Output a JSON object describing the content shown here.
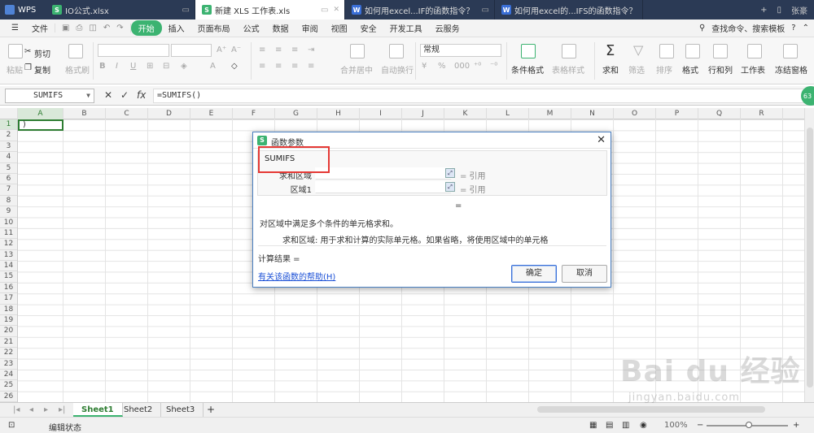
{
  "app": {
    "name": "WPS",
    "tabs": [
      {
        "label": "IO公式.xlsx",
        "icon": "S",
        "active": false
      },
      {
        "label": "新建 XLS 工作表.xls",
        "icon": "S",
        "active": true
      },
      {
        "label": "如何用excel...IF的函数指令？",
        "icon": "W",
        "active": false
      },
      {
        "label": "如何用excel的...IFS的函数指令？",
        "icon": "W",
        "active": false
      }
    ],
    "user": "张豪"
  },
  "menu": {
    "file": "文件",
    "start": "开始",
    "items": [
      "插入",
      "页面布局",
      "公式",
      "数据",
      "审阅",
      "视图",
      "安全",
      "开发工具",
      "云服务"
    ],
    "search": "查找命令、搜索模板"
  },
  "ribbon": {
    "paste": "粘贴",
    "cut": "剪切",
    "copy": "复制",
    "format_painter": "格式刷",
    "merge_center": "合并居中",
    "auto_wrap": "自动换行",
    "number_format": "常规",
    "conditional_format": "条件格式",
    "table_style": "表格样式",
    "sum": "求和",
    "filter": "筛选",
    "sort": "排序",
    "format": "格式",
    "row_col": "行和列",
    "worksheet": "工作表",
    "freeze": "冻结窗格",
    "percent": "%",
    "bold": "B",
    "italic": "I",
    "underline": "U",
    "font_a": "A"
  },
  "formula_bar": {
    "name_box": "SUMIFS",
    "fx": "fx",
    "formula": "=SUMIFS()",
    "badge": "63"
  },
  "grid": {
    "columns": [
      "A",
      "B",
      "C",
      "D",
      "E",
      "F",
      "G",
      "H",
      "I",
      "J",
      "K",
      "L",
      "M",
      "N",
      "O",
      "P",
      "Q",
      "R"
    ],
    "rows": [
      "1",
      "2",
      "3",
      "4",
      "5",
      "6",
      "7",
      "8",
      "9",
      "10",
      "11",
      "12",
      "13",
      "14",
      "15",
      "16",
      "17",
      "18",
      "19",
      "20",
      "21",
      "22",
      "23",
      "24",
      "25",
      "26"
    ],
    "active_cell_value": ")"
  },
  "sheets": [
    "Sheet1",
    "Sheet2",
    "Sheet3"
  ],
  "sheet_add": "+",
  "status": {
    "mode": "编辑状态",
    "zoom": "100%",
    "zoom_value": 100
  },
  "dialog": {
    "title": "函数参数",
    "function_name": "SUMIFS",
    "args": [
      {
        "label": "求和区域",
        "value": "",
        "ref": "= 引用"
      },
      {
        "label": "区域1",
        "value": "",
        "ref": "= 引用"
      }
    ],
    "equals": "=",
    "description": "对区域中满足多个条件的单元格求和。",
    "hint": "求和区域:  用于求和计算的实际单元格。如果省略，将使用区域中的单元格",
    "result_label": "计算结果  =",
    "help_link": "有关该函数的帮助(H)",
    "ok": "确定",
    "cancel": "取消"
  },
  "watermark": {
    "main": "Bai du 经验",
    "sub": "jingyan.baidu.com"
  },
  "colors": {
    "accent": "#3cb371",
    "titlebar": "#2b3a55",
    "highlight": "#e53935",
    "link": "#1a4fd6"
  }
}
